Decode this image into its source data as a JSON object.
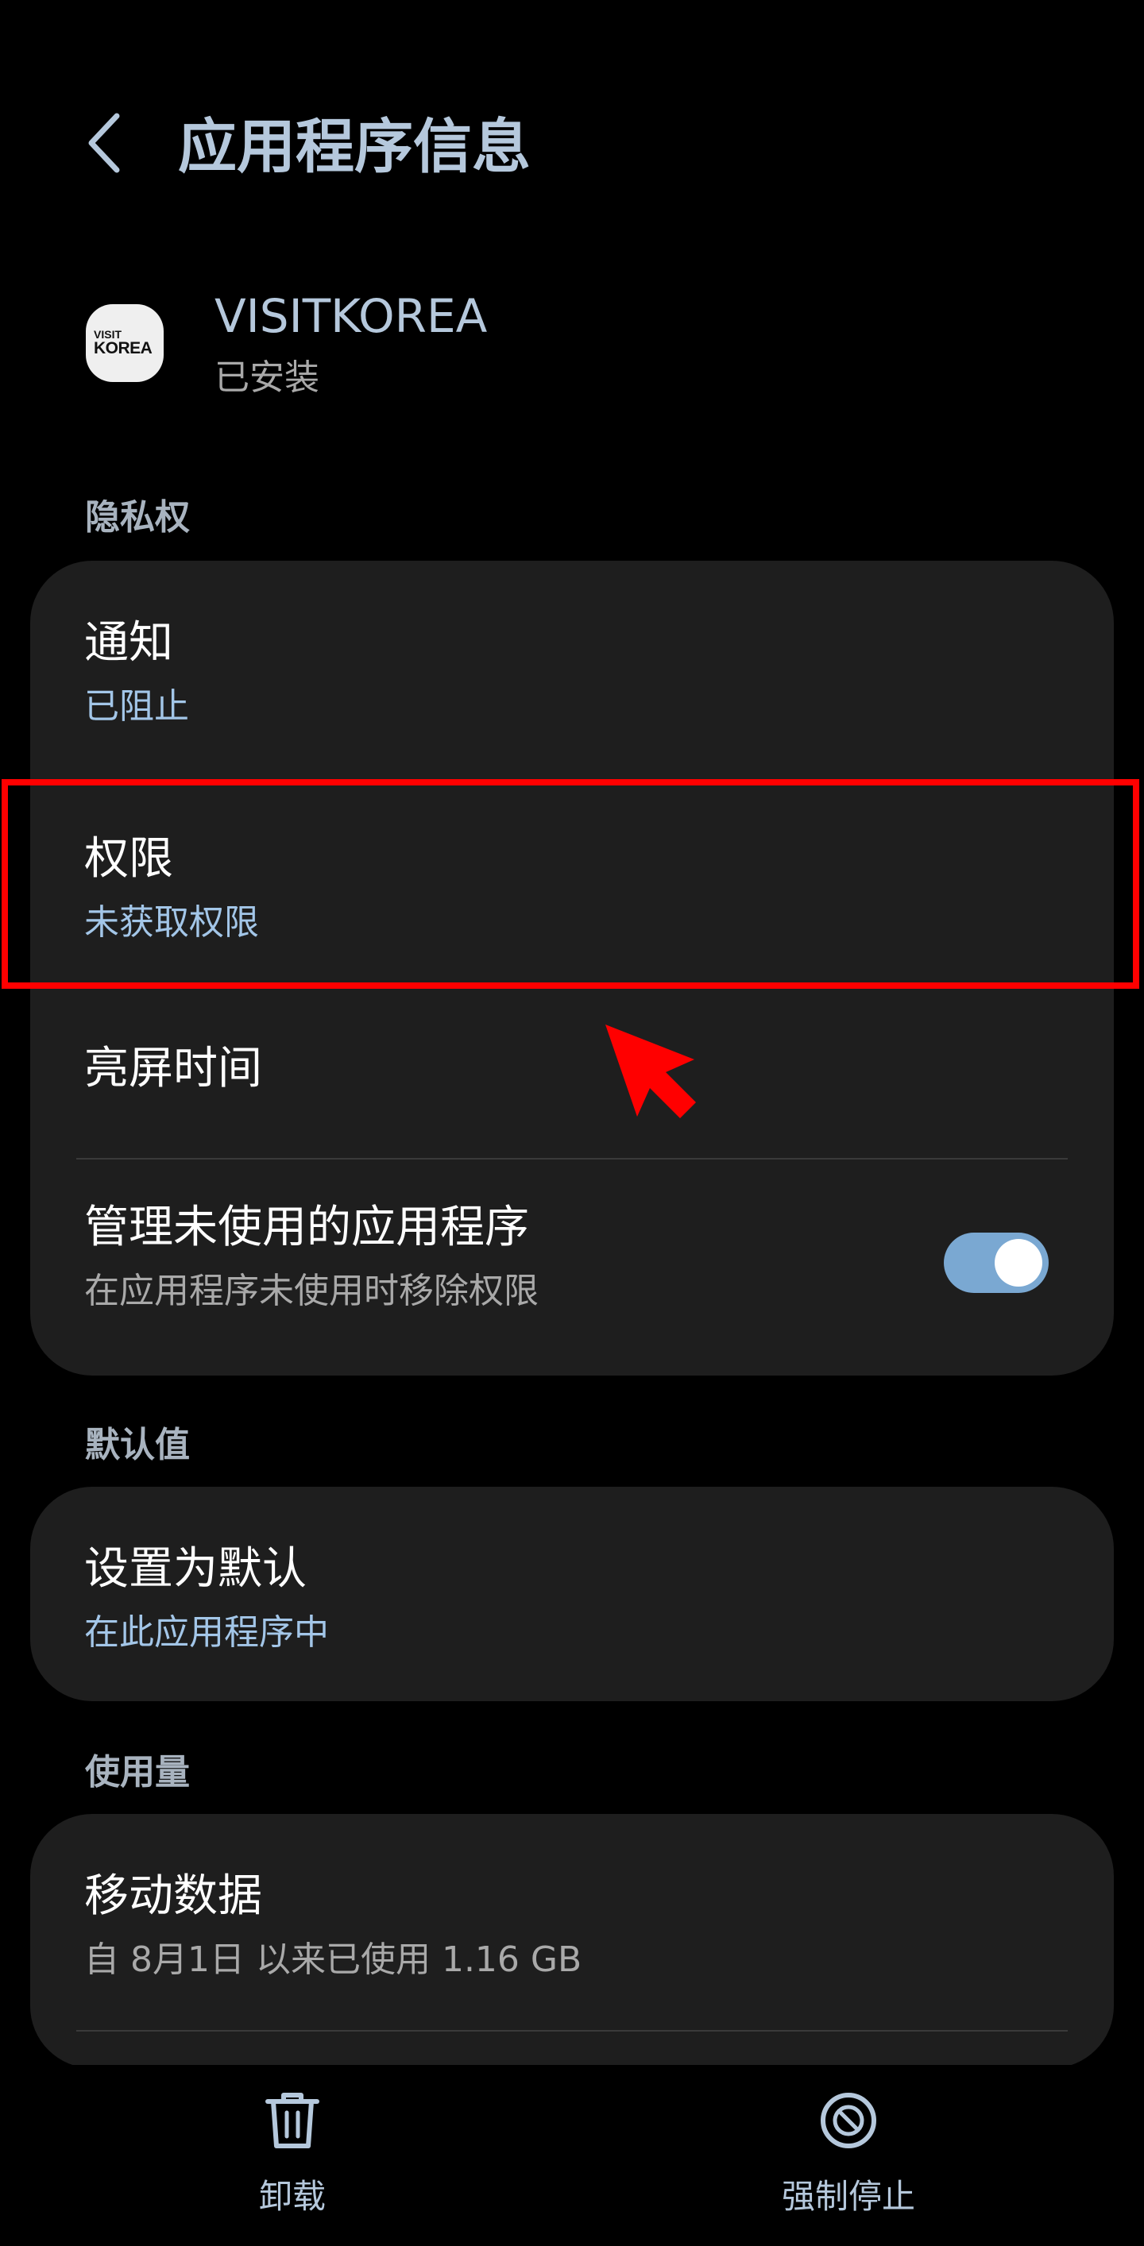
{
  "header": {
    "title": "应用程序信息",
    "back_icon": "chevron-left-icon"
  },
  "app": {
    "name": "VISITKOREA",
    "status": "已安装",
    "icon_text_small": "VISIT",
    "icon_text_big": "KOREA"
  },
  "sections": {
    "privacy": {
      "label": "隐私权",
      "items": [
        {
          "title": "通知",
          "subtitle": "已阻止"
        },
        {
          "title": "权限",
          "subtitle": "未获取权限"
        },
        {
          "title": "亮屏时间"
        },
        {
          "title": "管理未使用的应用程序",
          "subtitle": "在应用程序未使用时移除权限",
          "toggle_on": true
        }
      ]
    },
    "defaults": {
      "label": "默认值",
      "items": [
        {
          "title": "设置为默认",
          "subtitle": "在此应用程序中"
        }
      ]
    },
    "usage": {
      "label": "使用量",
      "items": [
        {
          "title": "移动数据",
          "subtitle": "自 8月1日 以来已使用 1.16 GB"
        }
      ]
    }
  },
  "bottom_bar": {
    "uninstall_label": "卸载",
    "force_stop_label": "强制停止",
    "uninstall_icon": "trash-icon",
    "force_stop_icon": "block-icon"
  },
  "colors": {
    "background": "#000000",
    "card": "#1e1e1e",
    "accent_blue": "#a3c6e8",
    "toggle_on": "#7aa8d2",
    "annotation_red": "#ff0000"
  }
}
